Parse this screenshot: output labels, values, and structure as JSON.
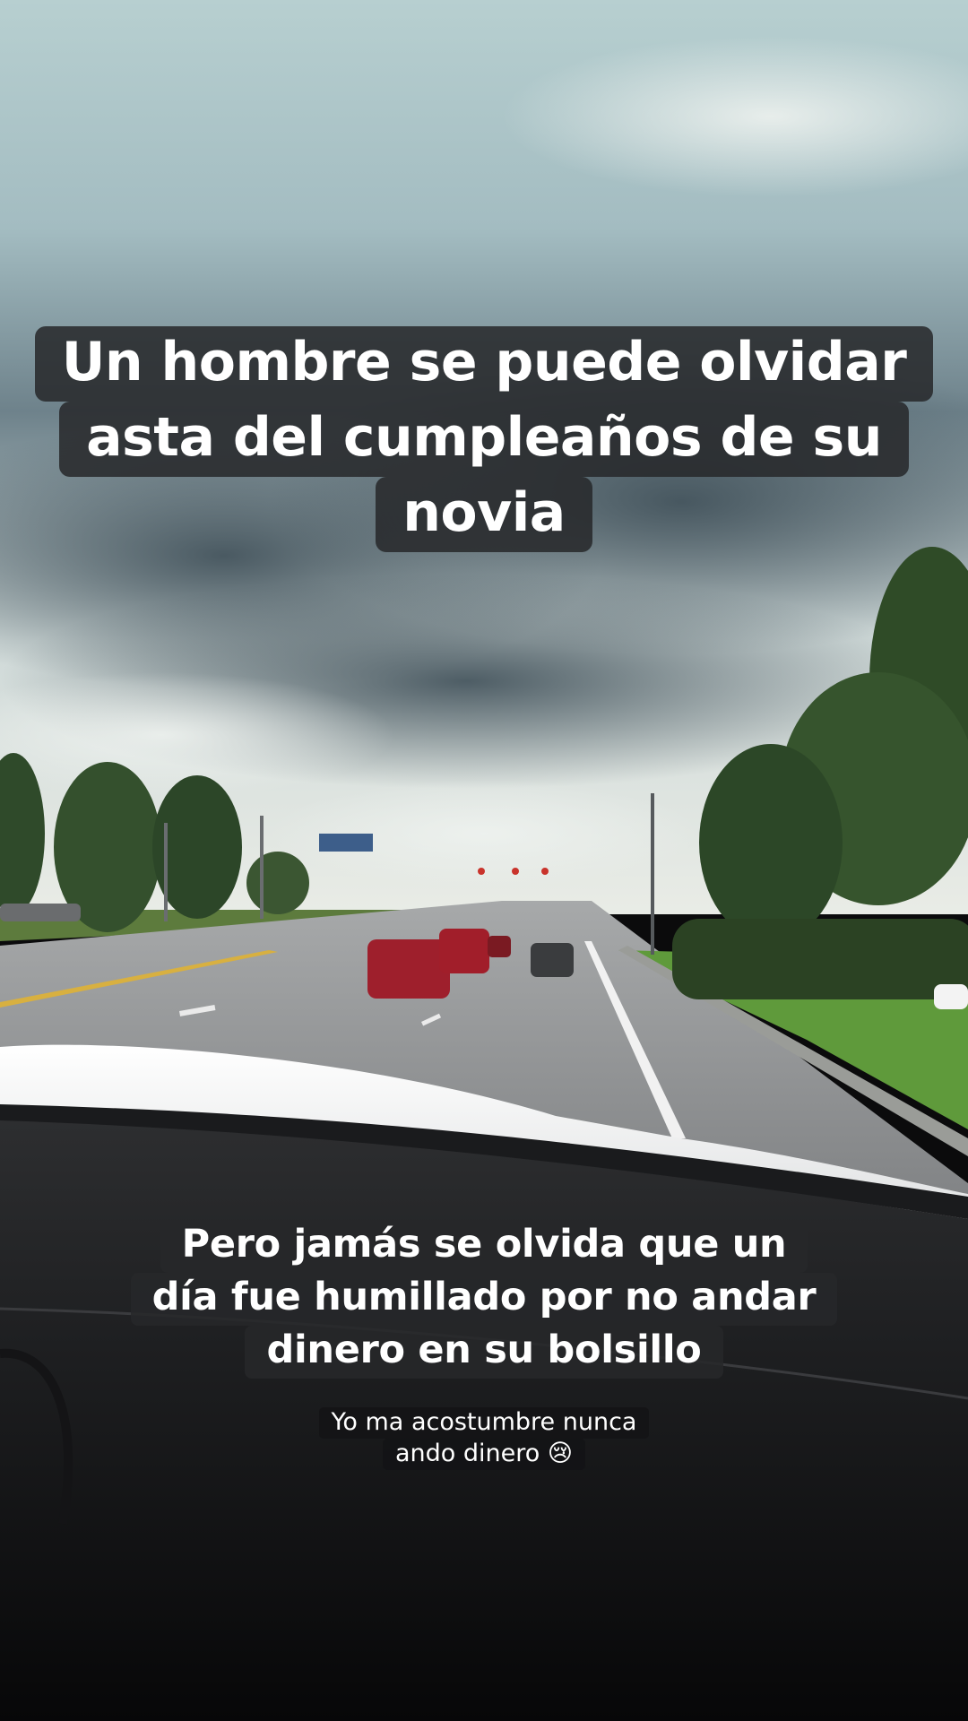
{
  "captions": {
    "top": {
      "lines": [
        "Un hombre se puede olvidar",
        "asta del cumpleaños de su",
        "novia"
      ]
    },
    "middle": {
      "lines": [
        "Pero jamás se olvida que un",
        "día fue humillado por no andar",
        "dinero en su bolsillo"
      ]
    },
    "bottom": {
      "lines": [
        "Yo ma acostumbre nunca",
        "ando dinero 😢"
      ]
    }
  },
  "scene": {
    "sky_color": "#a9c1c5",
    "cloud_color": "#4c5d66",
    "grass_color": "#5f8f3a",
    "road_color": "#8d8f91",
    "dashboard_color": "#1f2022",
    "hood_color": "#f2f3f3",
    "car_colors": [
      "#9e1f2c",
      "#a11e2a",
      "#7a1a22",
      "#3a3c3e"
    ]
  }
}
